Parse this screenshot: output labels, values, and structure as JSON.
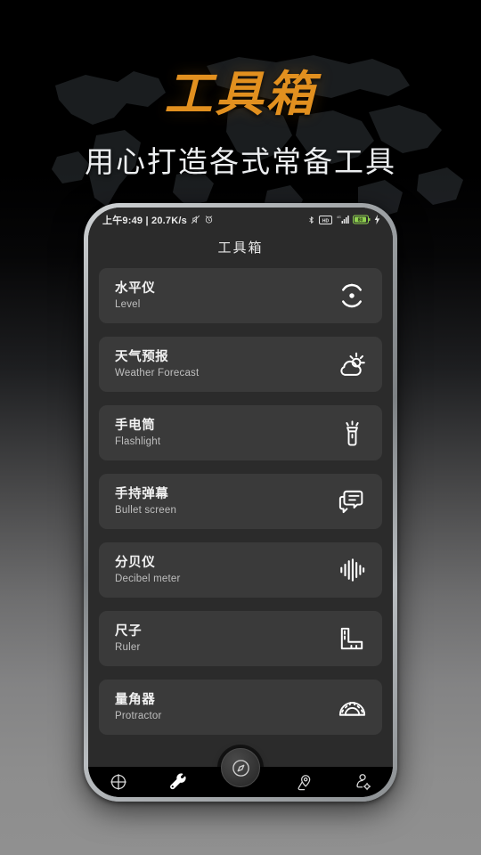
{
  "poster": {
    "title": "工具箱",
    "subtitle": "用心打造各式常备工具",
    "title_color": "#e2901f",
    "subtitle_color": "#eceef0",
    "background_motif": "world-map"
  },
  "phone": {
    "statusbar": {
      "time_text": "上午9:49 | 20.7K/s",
      "left_icons": [
        "mute-icon",
        "alarm-icon"
      ],
      "right_icons": [
        "bluetooth-icon",
        "hd-icon",
        "signal-icon",
        "battery-icon",
        "charging-icon"
      ],
      "battery_level": "80",
      "battery_color": "#8fd14f"
    },
    "appbar": {
      "title": "工具箱"
    },
    "tools": [
      {
        "cn": "水平仪",
        "en": "Level",
        "icon": "level-icon"
      },
      {
        "cn": "天气预报",
        "en": "Weather Forecast",
        "icon": "weather-icon"
      },
      {
        "cn": "手电筒",
        "en": "Flashlight",
        "icon": "flashlight-icon"
      },
      {
        "cn": "手持弹幕",
        "en": "Bullet screen",
        "icon": "bullet-screen-icon"
      },
      {
        "cn": "分贝仪",
        "en": "Decibel meter",
        "icon": "decibel-icon"
      },
      {
        "cn": "尺子",
        "en": "Ruler",
        "icon": "ruler-icon"
      },
      {
        "cn": "量角器",
        "en": "Protractor",
        "icon": "protractor-icon"
      }
    ],
    "bottomnav": {
      "items": [
        {
          "icon": "crosshair-icon",
          "active": false
        },
        {
          "icon": "wrench-icon",
          "active": true
        },
        {
          "icon": "location-pin-icon",
          "active": false
        },
        {
          "icon": "profile-settings-icon",
          "active": false
        }
      ],
      "fab_icon": "compass-icon"
    }
  }
}
